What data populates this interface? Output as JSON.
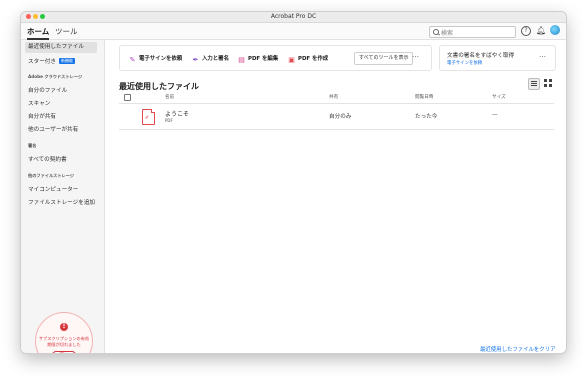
{
  "window": {
    "title": "Acrobat Pro DC"
  },
  "main_tabs": [
    {
      "label": "ホーム",
      "active": true
    },
    {
      "label": "ツール",
      "active": false
    }
  ],
  "topbar": {
    "search_placeholder": "検索",
    "help_glyph": "?"
  },
  "sidebar": {
    "recent": "最近使用したファイル",
    "starred": "スター付き",
    "new_badge": "新機能",
    "cloud_heading": "Adobe クラウドストレージ",
    "cloud_items": [
      "自分のファイル",
      "スキャン",
      "自分が共有",
      "他のユーザーが共有"
    ],
    "agreements_heading": "署名",
    "agreements_items": [
      "すべての契約書"
    ],
    "other_heading": "他のファイルストレージ",
    "other_items": [
      "マイコンピューター",
      "ファイルストレージを追加"
    ]
  },
  "subscription": {
    "alert_glyph": "!",
    "message": "サブスクリプションの有効期限が切れました",
    "buy_label": "購入"
  },
  "tools": [
    {
      "label": "電子サインを依頼",
      "icon": "sign-request-icon"
    },
    {
      "label": "入力と署名",
      "icon": "fill-sign-icon"
    },
    {
      "label": "PDF を編集",
      "icon": "edit-pdf-icon"
    },
    {
      "label": "PDF を作成",
      "icon": "create-pdf-icon"
    }
  ],
  "all_tools_label": "すべてのツールを表示",
  "more_glyph": "…",
  "signature_card": {
    "title": "文書の署名をすばやく取得",
    "link": "電子サインを依頼"
  },
  "recent_section": {
    "title": "最近使用したファイル",
    "columns": [
      "名前",
      "共有",
      "閲覧日時",
      "サイズ"
    ],
    "rows": [
      {
        "name": "ようこそ",
        "type": "PDF",
        "sharing": "自分のみ",
        "opened": "たった今",
        "size": "—"
      }
    ],
    "clear_link": "最近使用したファイルをクリア"
  },
  "colors": {
    "accent": "#1473e6",
    "alert": "#d7373f",
    "pdf": "#e34850"
  }
}
